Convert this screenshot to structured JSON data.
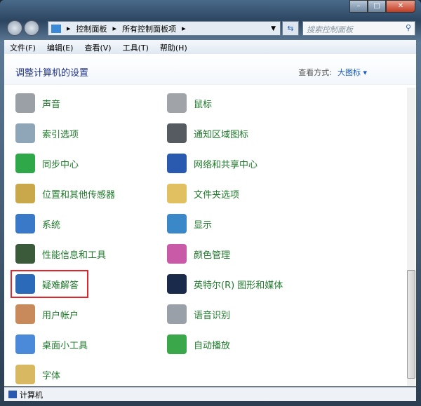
{
  "window": {
    "minimize": "–",
    "maximize": "□",
    "close": "✕"
  },
  "address": {
    "crumbs": [
      "控制面板",
      "所有控制面板项"
    ],
    "search_placeholder": "搜索控制面板"
  },
  "menu": [
    "文件(F)",
    "编辑(E)",
    "查看(V)",
    "工具(T)",
    "帮助(H)"
  ],
  "header": {
    "title": "调整计算机的设置",
    "view_label": "查看方式:",
    "view_value": "大图标 ▾"
  },
  "items_left": [
    {
      "label": "声音",
      "icon": "speaker-icon",
      "color": "#9aa0a6"
    },
    {
      "label": "索引选项",
      "icon": "magnifier-icon",
      "color": "#8fa5b8"
    },
    {
      "label": "同步中心",
      "icon": "sync-icon",
      "color": "#2fa84a"
    },
    {
      "label": "位置和其他传感器",
      "icon": "sensor-icon",
      "color": "#c8a84a"
    },
    {
      "label": "系统",
      "icon": "computer-icon",
      "color": "#3a78c8"
    },
    {
      "label": "性能信息和工具",
      "icon": "performance-icon",
      "color": "#3a5a3a"
    },
    {
      "label": "疑难解答",
      "icon": "troubleshoot-icon",
      "color": "#2a6ab8"
    },
    {
      "label": "用户帐户",
      "icon": "users-icon",
      "color": "#c88a5a"
    },
    {
      "label": "桌面小工具",
      "icon": "gadgets-icon",
      "color": "#4a8ad8"
    },
    {
      "label": "字体",
      "icon": "font-icon",
      "color": "#d8b860"
    }
  ],
  "items_right": [
    {
      "label": "鼠标",
      "icon": "mouse-icon",
      "color": "#a0a4a8"
    },
    {
      "label": "通知区域图标",
      "icon": "notification-icon",
      "color": "#555b60"
    },
    {
      "label": "网络和共享中心",
      "icon": "network-icon",
      "color": "#2a5ab0"
    },
    {
      "label": "文件夹选项",
      "icon": "folder-icon",
      "color": "#e0c060"
    },
    {
      "label": "显示",
      "icon": "display-icon",
      "color": "#3a88c8"
    },
    {
      "label": "颜色管理",
      "icon": "color-icon",
      "color": "#c85aa8"
    },
    {
      "label": "英特尔(R) 图形和媒体",
      "icon": "intel-graphics-icon",
      "color": "#1a2a4a"
    },
    {
      "label": "语音识别",
      "icon": "microphone-icon",
      "color": "#9aa0a8"
    },
    {
      "label": "自动播放",
      "icon": "autoplay-icon",
      "color": "#3aa84a"
    }
  ],
  "status": {
    "label": "计算机"
  }
}
